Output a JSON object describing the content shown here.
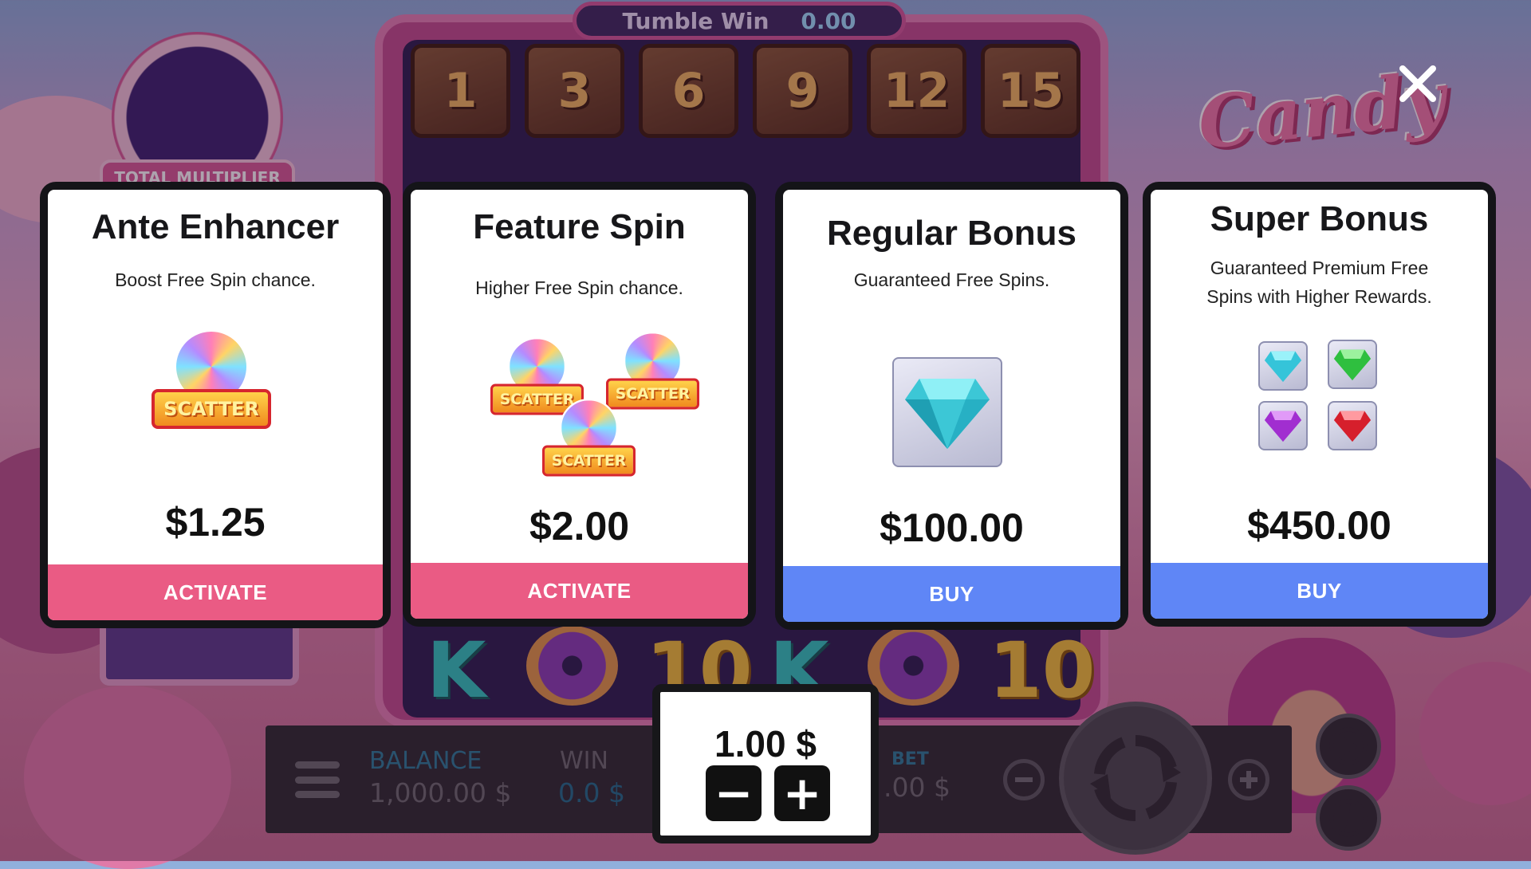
{
  "game": {
    "tumble_win_label": "Tumble Win",
    "tumble_win_value": "0.00",
    "multipliers": [
      "1",
      "3",
      "6",
      "9",
      "12",
      "15"
    ],
    "total_multiplier_label": "TOTAL MULTIPLIER",
    "logo_text": "Candy",
    "reel_symbols": [
      "K",
      "10",
      "K",
      "10"
    ]
  },
  "cards": [
    {
      "title": "Ante Enhancer",
      "desc": "Boost Free Spin chance.",
      "price": "$1.25",
      "button": "ACTIVATE",
      "scatter_text": "SCATTER"
    },
    {
      "title": "Feature Spin",
      "desc": "Higher Free Spin chance.",
      "price": "$2.00",
      "button": "ACTIVATE",
      "scatter_text": "SCATTER"
    },
    {
      "title": "Regular Bonus",
      "desc": "Guaranteed Free Spins.",
      "price": "$100.00",
      "button": "BUY"
    },
    {
      "title": "Super Bonus",
      "desc_line1": "Guaranteed Premium Free",
      "desc_line2": "Spins with Higher Rewards.",
      "price": "$450.00",
      "button": "BUY"
    }
  ],
  "bet_popup": {
    "value": "1.00 $",
    "minus": "−",
    "plus": "+"
  },
  "hud": {
    "balance_label": "BALANCE",
    "balance_value": "1,000.00 $",
    "win_label": "WIN",
    "win_value": "0.0 $",
    "bet_label": "BET",
    "bet_value": ".00 $"
  },
  "icons": {
    "close": "close-icon",
    "menu": "menu-icon",
    "spin": "spin-icon",
    "autoplay": "play-icon",
    "turbo": "turbo-icon"
  },
  "colors": {
    "activate_button": "#ea5b84",
    "buy_button": "#5f86f6"
  }
}
